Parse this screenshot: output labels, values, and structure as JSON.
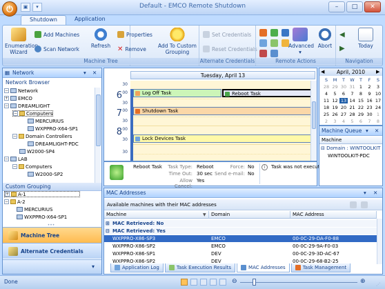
{
  "window": {
    "title": "Default - EMCO Remote Shutdown",
    "buttons": {
      "minimize": "–",
      "maximize": "□",
      "close": "✕"
    }
  },
  "ribbon": {
    "tabs": [
      "Shutdown",
      "Application"
    ],
    "active_tab": "Shutdown",
    "groups": {
      "machine_tree": {
        "label": "Machine Tree",
        "enumeration_wizard": "Enumeration Wizard",
        "add_machines": "Add Machines",
        "scan_network": "Scan Network",
        "refresh": "Refresh",
        "properties": "Properties",
        "remove": "Remove",
        "add_to_custom_grouping": "Add To Custom Grouping"
      },
      "alternate_credentials": {
        "label": "Alternate Credentials",
        "set_credentials": "Set Credentials",
        "reset_credentials": "Reset Credentials"
      },
      "remote_actions": {
        "label": "Remote Actions",
        "advanced": "Advanced",
        "abort": "Abort"
      },
      "navigation": {
        "label": "Navigation",
        "today": "Today"
      }
    }
  },
  "left_panel": {
    "header": "Network",
    "network_browser_label": "Network Browser",
    "tree": [
      {
        "label": "Network",
        "level": 0
      },
      {
        "label": "EMCO",
        "level": 1
      },
      {
        "label": "DREAMLIGHT",
        "level": 1
      },
      {
        "label": "Computers",
        "level": 2
      },
      {
        "label": "MERCURIUS",
        "level": 3
      },
      {
        "label": "WXPPRO-X64-SP1",
        "level": 3
      },
      {
        "label": "Domain Controllers",
        "level": 2
      },
      {
        "label": "DREAMLIGHT-PDC",
        "level": 3
      },
      {
        "label": "W2000-SP4",
        "level": 2
      },
      {
        "label": "LAB",
        "level": 1
      },
      {
        "label": "Computers",
        "level": 2
      },
      {
        "label": "W2000-SP2",
        "level": 3
      }
    ],
    "custom_grouping_label": "Custom Grouping",
    "custom_tree": [
      {
        "label": "A-1",
        "level": 0
      },
      {
        "label": "A-2",
        "level": 0
      },
      {
        "label": "MERCURIUS",
        "level": 1
      },
      {
        "label": "WXPPRO-X64-SP1",
        "level": 1
      }
    ],
    "nav_buttons": {
      "machine_tree": "Machine Tree",
      "alternate_credentials": "Alternate Credentials"
    }
  },
  "scheduler": {
    "day_header": "Tuesday, April 13",
    "times": [
      {
        "hour": "6",
        "suffix": "00"
      },
      {
        "hour": "7",
        "suffix": "00"
      },
      {
        "hour": "8",
        "suffix": "00"
      }
    ],
    "half": "30",
    "appointments": [
      {
        "label": "Log Off Task"
      },
      {
        "label": "Reboot Task"
      },
      {
        "label": "Shutdown Task"
      },
      {
        "label": "Lock Devices Task"
      }
    ]
  },
  "details": {
    "task_name": "Reboot Task",
    "task_type_label": "Task Type:",
    "task_type": "Reboot",
    "force_label": "Force:",
    "force": "No",
    "time_out_label": "Time Out:",
    "time_out": "30 sec",
    "send_email_label": "Send e-mail:",
    "send_email": "No",
    "allow_cancel_label": "Allow Cancel:",
    "allow_cancel": "Yes",
    "status_message": "Task was not executed before."
  },
  "calendar": {
    "month": "April, 2010",
    "day_headers": [
      "S",
      "M",
      "T",
      "W",
      "T",
      "F",
      "S"
    ],
    "weeks": [
      [
        "28",
        "29",
        "30",
        "31",
        "1",
        "2",
        "3"
      ],
      [
        "4",
        "5",
        "6",
        "7",
        "8",
        "9",
        "10"
      ],
      [
        "11",
        "12",
        "13",
        "14",
        "15",
        "16",
        "17"
      ],
      [
        "18",
        "19",
        "20",
        "21",
        "22",
        "23",
        "24"
      ],
      [
        "25",
        "26",
        "27",
        "28",
        "29",
        "30",
        "1"
      ],
      [
        "2",
        "3",
        "4",
        "5",
        "6",
        "7",
        "8"
      ]
    ],
    "selected_day": "13"
  },
  "machine_queue": {
    "header": "Machine Queue",
    "column": "Machine",
    "group_label": "Domain : WINTOOLKIT",
    "items": [
      "WINTOOLKIT-PDC"
    ]
  },
  "mac_panel": {
    "header": "MAC Addresses",
    "subheader": "Available machines with their MAC addresses",
    "columns": [
      "Machine",
      "Domain",
      "MAC Address"
    ],
    "groups": [
      {
        "label": "MAC Retrieved: No",
        "rows": []
      },
      {
        "label": "MAC Retrieved: Yes",
        "rows": [
          {
            "machine": "WXPPRO-X86-SP3",
            "domain": "EMCO",
            "mac": "00-0C-29-DA-F0-88"
          },
          {
            "machine": "WXPPRO-X86-SP2",
            "domain": "EMCO",
            "mac": "00-0C-29-9A-F0-03"
          },
          {
            "machine": "WXPPRO-X86-SP1",
            "domain": "DEV",
            "mac": "00-0C-29-3D-AC-67"
          },
          {
            "machine": "WXPPRO-X86-SP2",
            "domain": "DEV",
            "mac": "00-0C-29-68-B2-25"
          }
        ]
      }
    ],
    "selected_row": 0
  },
  "bottom_tabs": [
    "Application Log",
    "Task Execution Results",
    "MAC Addresses",
    "Task Management"
  ],
  "active_bottom_tab": "MAC Addresses",
  "status": {
    "text": "Done"
  }
}
